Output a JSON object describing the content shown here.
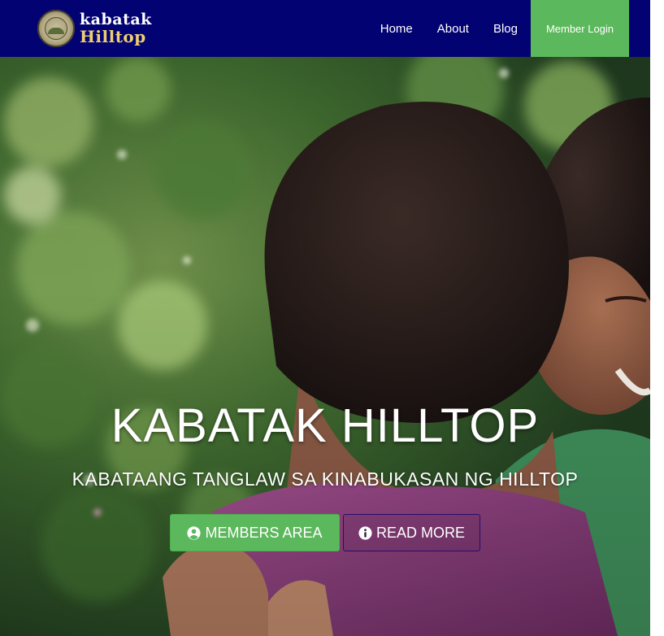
{
  "brand": {
    "line1": "kabatak",
    "line2": "Hilltop",
    "logo_icon": "organization-seal-icon"
  },
  "nav": {
    "items": [
      {
        "label": "Home"
      },
      {
        "label": "About"
      },
      {
        "label": "Blog"
      }
    ],
    "login_label": "Member Login"
  },
  "hero": {
    "title": "KABATAK HILLTOP",
    "subtitle": "KABATAANG TANGLAW SA KINABUKASAN NG HILLTOP",
    "buttons": {
      "members_label": "MEMBERS AREA",
      "members_icon": "user-circle-icon",
      "read_more_label": "READ MORE",
      "read_more_icon": "info-circle-icon"
    },
    "image_alt_subject": "children-playing-photo"
  },
  "colors": {
    "navbar_bg": "#030272",
    "accent_green": "#5cb85c",
    "brand_gold": "#f0cf73",
    "read_more_border": "#2a0b6a"
  }
}
